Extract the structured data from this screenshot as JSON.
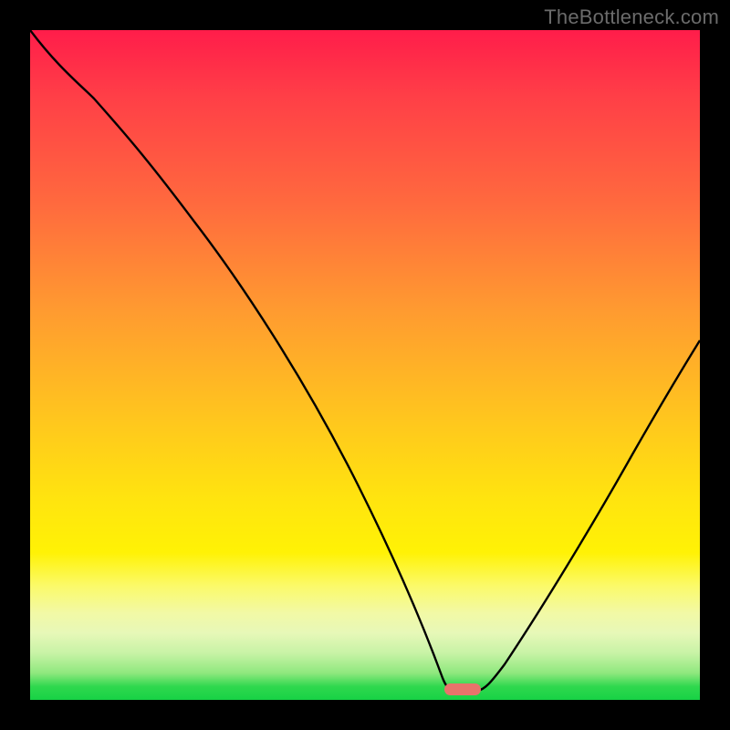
{
  "watermark": "TheBottleneck.com",
  "colors": {
    "frame": "#000000",
    "curve": "#000000",
    "marker": "#e9736b",
    "baseline": "#17d245"
  },
  "chart_data": {
    "type": "line",
    "title": "",
    "xlabel": "",
    "ylabel": "",
    "xlim": [
      0,
      100
    ],
    "ylim": [
      0,
      100
    ],
    "grid": false,
    "legend": false,
    "notes": "Image has no axis ticks or labels; values are read as percentages of the plot area (0 at bottom-left). Curve is a V-shape with minimum near x≈64 touching y≈0, rising to the right and to the top-left.",
    "series": [
      {
        "name": "bottleneck-curve",
        "x": [
          0,
          8,
          18,
          26,
          36,
          46,
          54,
          60,
          62.5,
          67,
          72,
          80,
          90,
          100
        ],
        "y": [
          100,
          91,
          79,
          70,
          55,
          38,
          22,
          9,
          1.5,
          1.2,
          6,
          18,
          35,
          54
        ]
      }
    ],
    "marker": {
      "x": 64.5,
      "y": 1.2,
      "shape": "pill",
      "color": "#e9736b"
    }
  }
}
